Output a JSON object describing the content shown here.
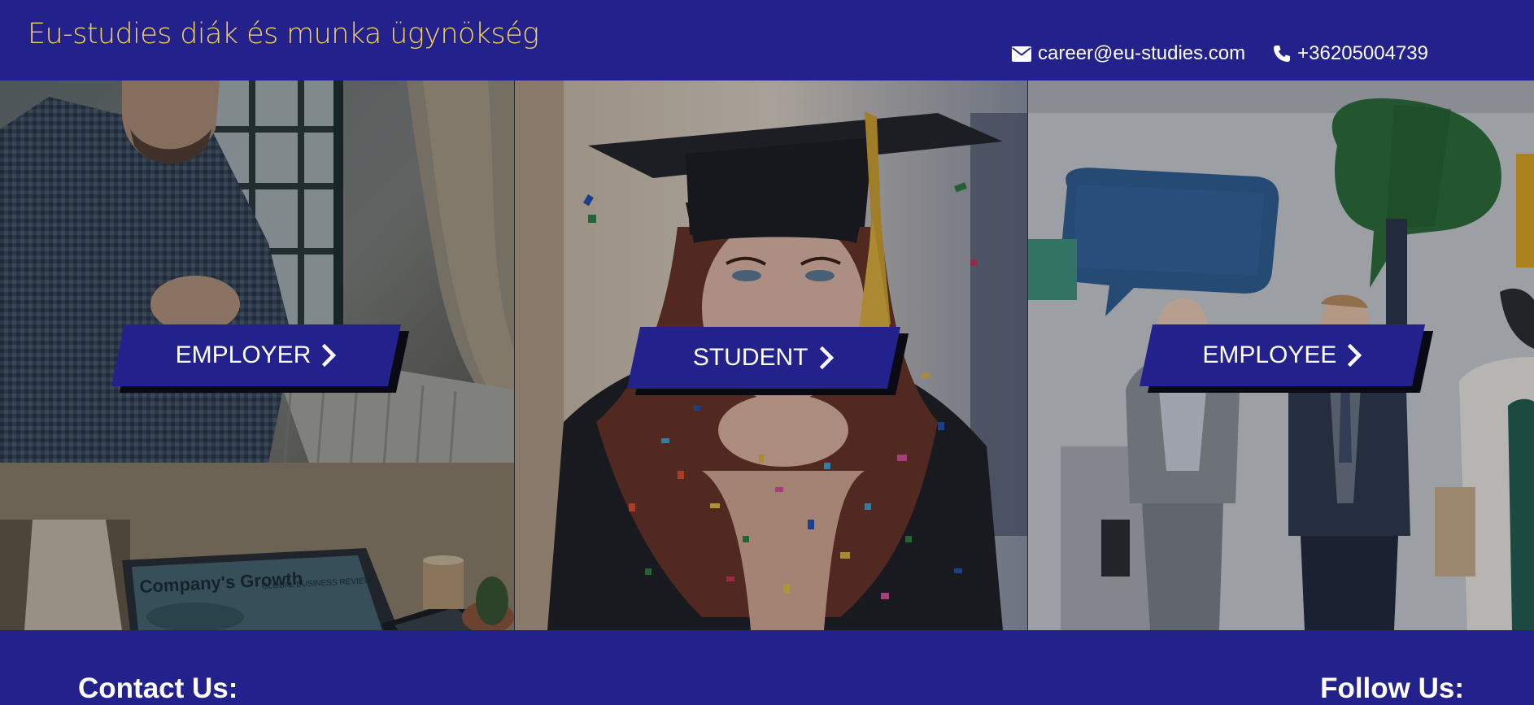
{
  "header": {
    "brand": "Eu-studies diák és munka ügynökség",
    "email": "career@eu-studies.com",
    "phone": "+36205004739",
    "email_icon": "envelope-icon",
    "phone_icon": "phone-icon"
  },
  "panels": [
    {
      "label": "EMPLOYER",
      "icon": "chevron-right-icon",
      "image": "handshake-office-photo",
      "laptop_text": "Company's Growth",
      "laptop_sub": "GLOBAL BUSINESS REVIEW"
    },
    {
      "label": "STUDENT",
      "icon": "chevron-right-icon",
      "image": "graduate-confetti-photo"
    },
    {
      "label": "EMPLOYEE",
      "icon": "chevron-right-icon",
      "image": "employees-speech-bubbles-photo"
    }
  ],
  "footer": {
    "contact_title": "Contact Us:",
    "follow_title": "Follow Us:"
  },
  "colors": {
    "brand_blue": "#23218c",
    "brand_yellow": "#f5cf5e",
    "text_white": "#ffffff"
  }
}
